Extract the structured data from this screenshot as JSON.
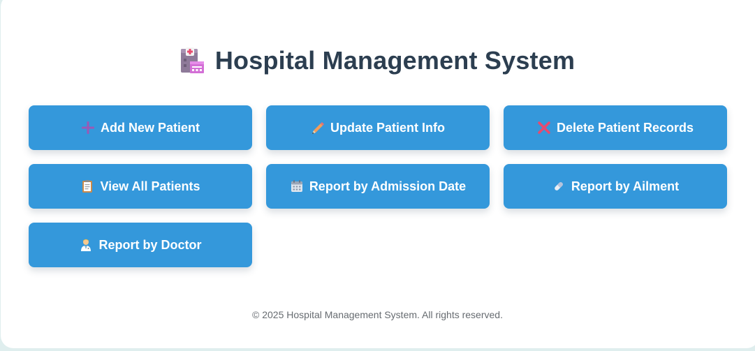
{
  "header": {
    "title": "Hospital Management System",
    "icon": "hospital-icon"
  },
  "menu": {
    "add_patient": {
      "label": "Add New Patient",
      "icon": "plus-icon"
    },
    "update_patient": {
      "label": "Update Patient Info",
      "icon": "pencil-icon"
    },
    "delete_records": {
      "label": "Delete Patient Records",
      "icon": "cross-mark-icon"
    },
    "view_all": {
      "label": "View All Patients",
      "icon": "clipboard-icon"
    },
    "report_admission": {
      "label": "Report by Admission Date",
      "icon": "calendar-icon"
    },
    "report_ailment": {
      "label": "Report by Ailment",
      "icon": "pill-icon"
    },
    "report_doctor": {
      "label": "Report by Doctor",
      "icon": "doctor-icon"
    }
  },
  "footer": {
    "copyright": "© 2025 Hospital Management System. All rights reserved."
  },
  "colors": {
    "button_bg": "#3498db",
    "title": "#2c3e50",
    "background": "#dfeeee"
  }
}
